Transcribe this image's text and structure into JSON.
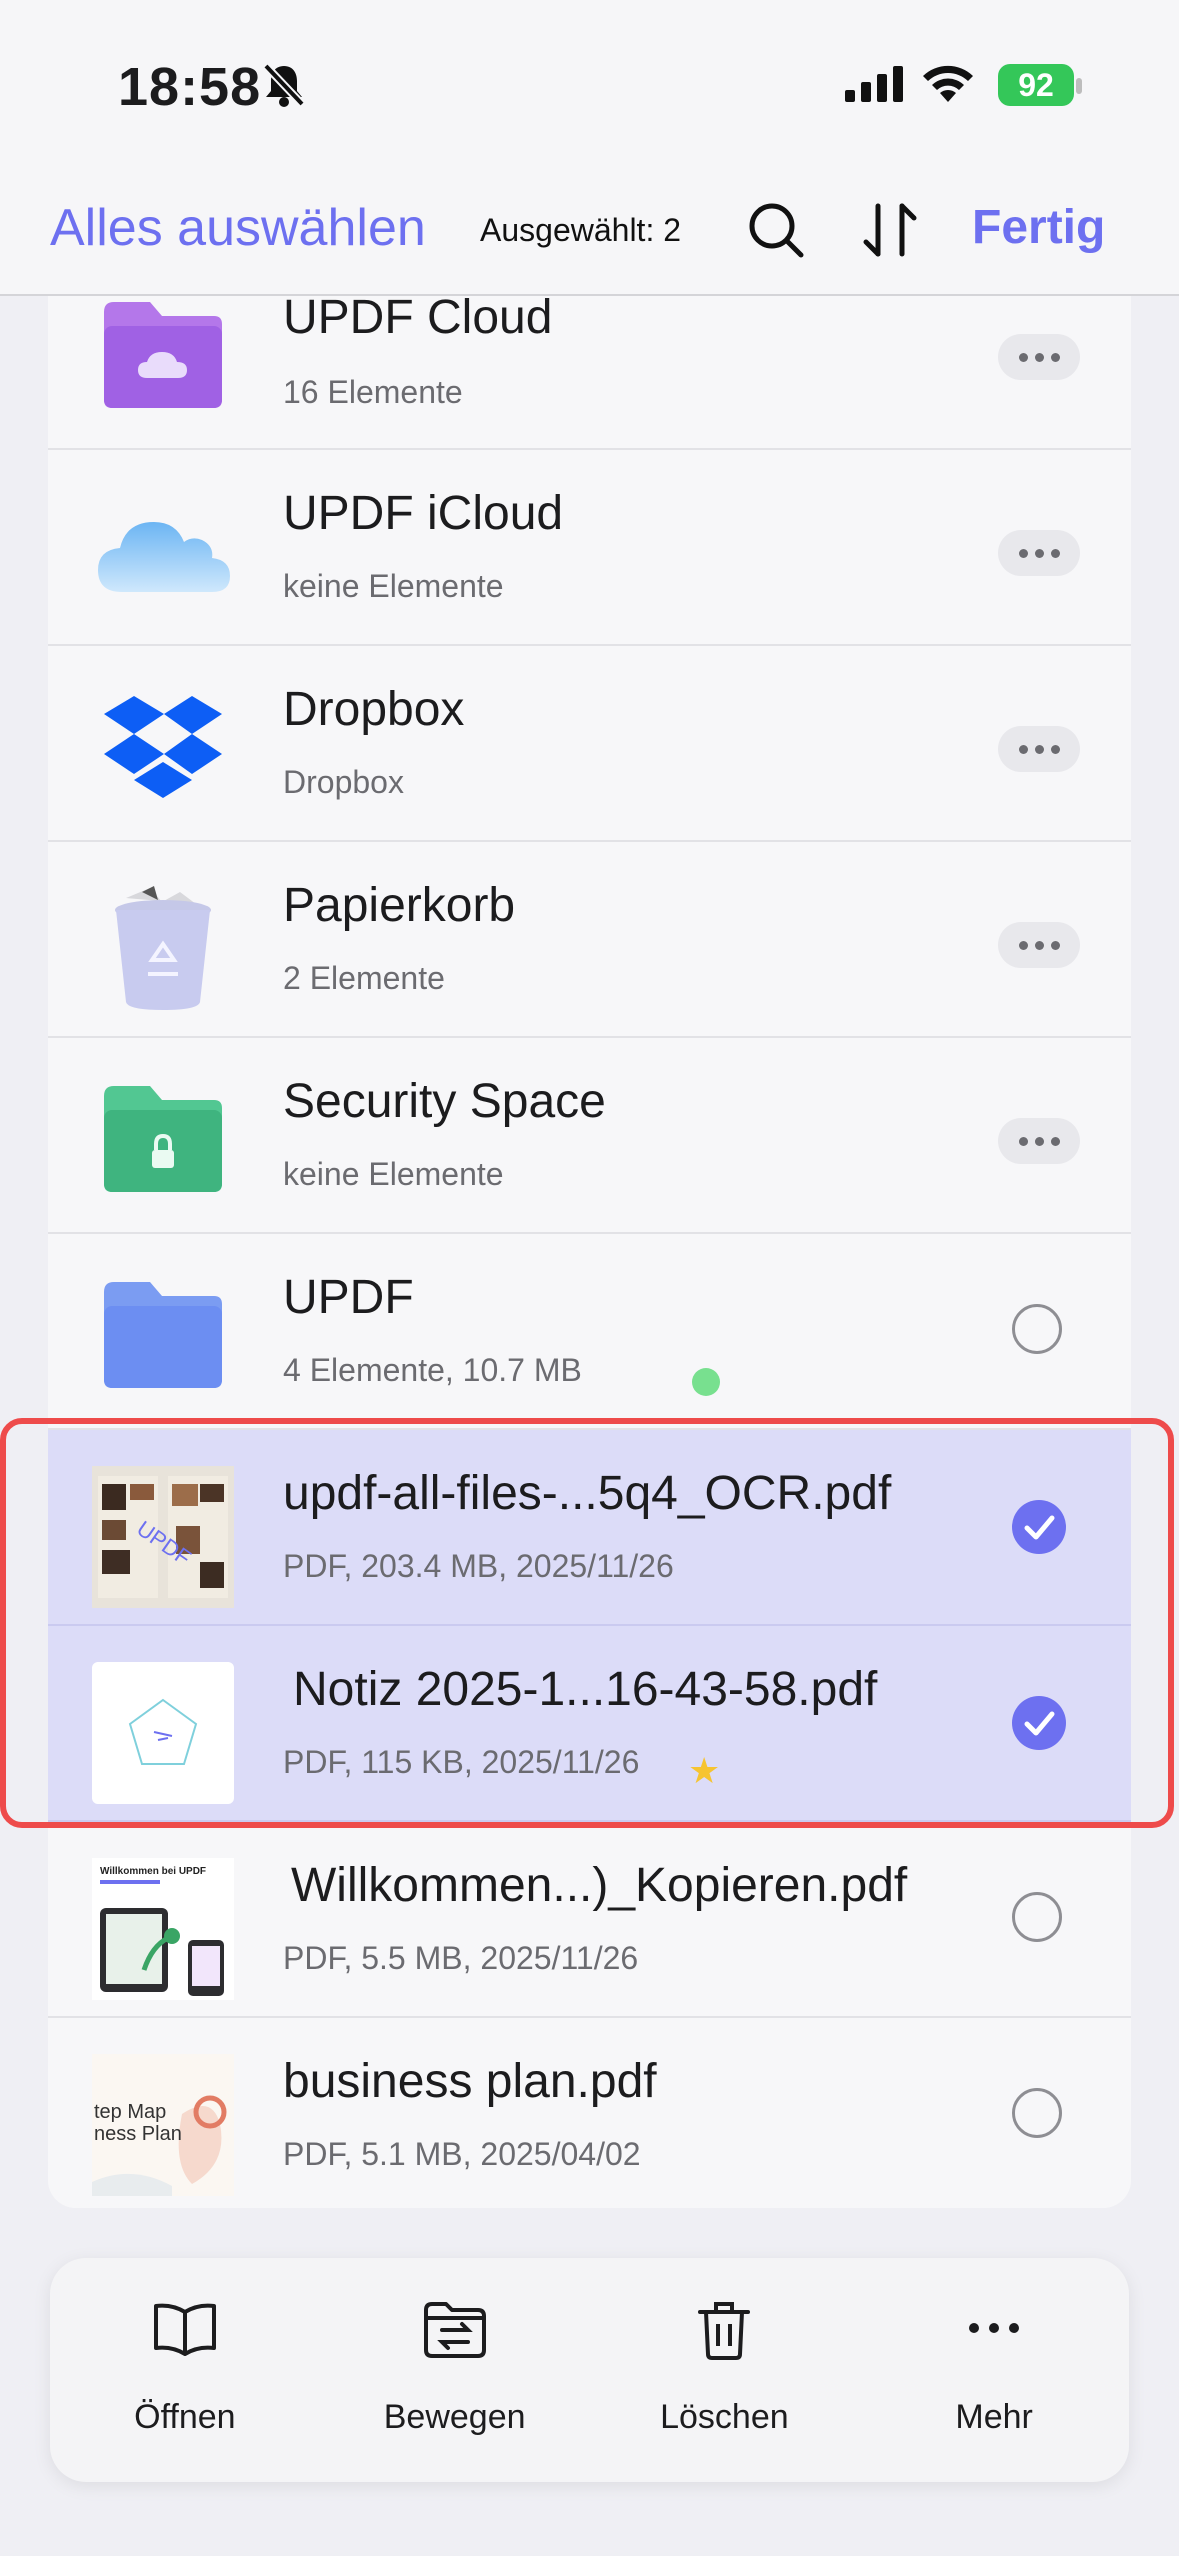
{
  "status_bar": {
    "time": "18:58",
    "battery": "92"
  },
  "nav": {
    "select_all": "Alles auswählen",
    "selected_count": "Ausgewählt: 2",
    "done": "Fertig"
  },
  "items": [
    {
      "title": "UPDF Cloud",
      "subtitle": "16 Elemente",
      "icon": "cloud-folder-icon",
      "control": "more"
    },
    {
      "title": "UPDF iCloud",
      "subtitle": "keine Elemente",
      "icon": "icloud-icon",
      "control": "more"
    },
    {
      "title": "Dropbox",
      "subtitle": "Dropbox",
      "icon": "dropbox-icon",
      "control": "more"
    },
    {
      "title": "Papierkorb",
      "subtitle": "2 Elemente",
      "icon": "trash-bin-icon",
      "control": "more"
    },
    {
      "title": "Security Space",
      "subtitle": "keine Elemente",
      "icon": "lock-folder-icon",
      "control": "more"
    },
    {
      "title": "UPDF",
      "subtitle": "4 Elemente, 10.7 MB",
      "icon": "folder-icon",
      "control": "radio",
      "tag": "green"
    },
    {
      "title": "updf-all-files-...5q4_OCR.pdf",
      "subtitle": "PDF, 203.4 MB, 2025/11/26",
      "icon": "pdf-thumbnail",
      "control": "checked",
      "selected": true
    },
    {
      "title": "Notiz 2025-1...16-43-58.pdf",
      "subtitle": "PDF, 115 KB, 2025/11/26",
      "icon": "note-thumbnail",
      "control": "checked",
      "selected": true,
      "starred": true
    },
    {
      "title": "Willkommen...)_Kopieren.pdf",
      "subtitle": "PDF, 5.5 MB, 2025/11/26",
      "icon": "pdf-thumbnail",
      "control": "radio",
      "thumb_text": "Willkommen bei UPDF"
    },
    {
      "title": "business plan.pdf",
      "subtitle": "PDF, 5.1 MB, 2025/04/02",
      "icon": "pdf-thumbnail",
      "control": "radio",
      "thumb_text": "tep Map\nness Plan"
    }
  ],
  "toolbar": {
    "open": "Öffnen",
    "move": "Bewegen",
    "delete": "Löschen",
    "more": "Mehr"
  },
  "colors": {
    "accent": "#6d70f0",
    "selected_row": "#dcdcf8",
    "highlight_border": "#ee4b4b"
  }
}
